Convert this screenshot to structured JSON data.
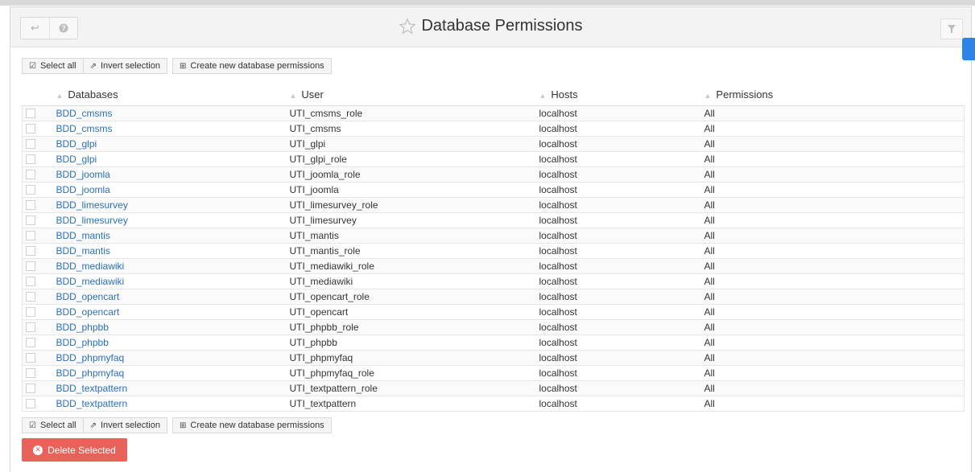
{
  "header": {
    "title": "Database Permissions",
    "back_icon": "back-arrow-icon",
    "help_icon": "help-icon",
    "star_icon": "star-outline-icon",
    "filter_icon": "filter-icon"
  },
  "toolbar": {
    "select_all": "Select all",
    "invert_selection": "Invert selection",
    "create_new": "Create new database permissions"
  },
  "table": {
    "columns": [
      "Databases",
      "User",
      "Hosts",
      "Permissions"
    ],
    "rows": [
      {
        "db": "BDD_cmsms",
        "user": "UTI_cmsms_role",
        "host": "localhost",
        "perm": "All"
      },
      {
        "db": "BDD_cmsms",
        "user": "UTI_cmsms",
        "host": "localhost",
        "perm": "All"
      },
      {
        "db": "BDD_glpi",
        "user": "UTI_glpi",
        "host": "localhost",
        "perm": "All"
      },
      {
        "db": "BDD_glpi",
        "user": "UTI_glpi_role",
        "host": "localhost",
        "perm": "All"
      },
      {
        "db": "BDD_joomla",
        "user": "UTI_joomla_role",
        "host": "localhost",
        "perm": "All"
      },
      {
        "db": "BDD_joomla",
        "user": "UTI_joomla",
        "host": "localhost",
        "perm": "All"
      },
      {
        "db": "BDD_limesurvey",
        "user": "UTI_limesurvey_role",
        "host": "localhost",
        "perm": "All"
      },
      {
        "db": "BDD_limesurvey",
        "user": "UTI_limesurvey",
        "host": "localhost",
        "perm": "All"
      },
      {
        "db": "BDD_mantis",
        "user": "UTI_mantis",
        "host": "localhost",
        "perm": "All"
      },
      {
        "db": "BDD_mantis",
        "user": "UTI_mantis_role",
        "host": "localhost",
        "perm": "All"
      },
      {
        "db": "BDD_mediawiki",
        "user": "UTI_mediawiki_role",
        "host": "localhost",
        "perm": "All"
      },
      {
        "db": "BDD_mediawiki",
        "user": "UTI_mediawiki",
        "host": "localhost",
        "perm": "All"
      },
      {
        "db": "BDD_opencart",
        "user": "UTI_opencart_role",
        "host": "localhost",
        "perm": "All"
      },
      {
        "db": "BDD_opencart",
        "user": "UTI_opencart",
        "host": "localhost",
        "perm": "All"
      },
      {
        "db": "BDD_phpbb",
        "user": "UTI_phpbb_role",
        "host": "localhost",
        "perm": "All"
      },
      {
        "db": "BDD_phpbb",
        "user": "UTI_phpbb",
        "host": "localhost",
        "perm": "All"
      },
      {
        "db": "BDD_phpmyfaq",
        "user": "UTI_phpmyfaq",
        "host": "localhost",
        "perm": "All"
      },
      {
        "db": "BDD_phpmyfaq",
        "user": "UTI_phpmyfaq_role",
        "host": "localhost",
        "perm": "All"
      },
      {
        "db": "BDD_textpattern",
        "user": "UTI_textpattern_role",
        "host": "localhost",
        "perm": "All"
      },
      {
        "db": "BDD_textpattern",
        "user": "UTI_textpattern",
        "host": "localhost",
        "perm": "All"
      }
    ]
  },
  "footer": {
    "delete_selected": "Delete Selected"
  },
  "colors": {
    "link": "#2a6fba",
    "danger": "#e8625a",
    "side_tab": "#2e83e6"
  }
}
